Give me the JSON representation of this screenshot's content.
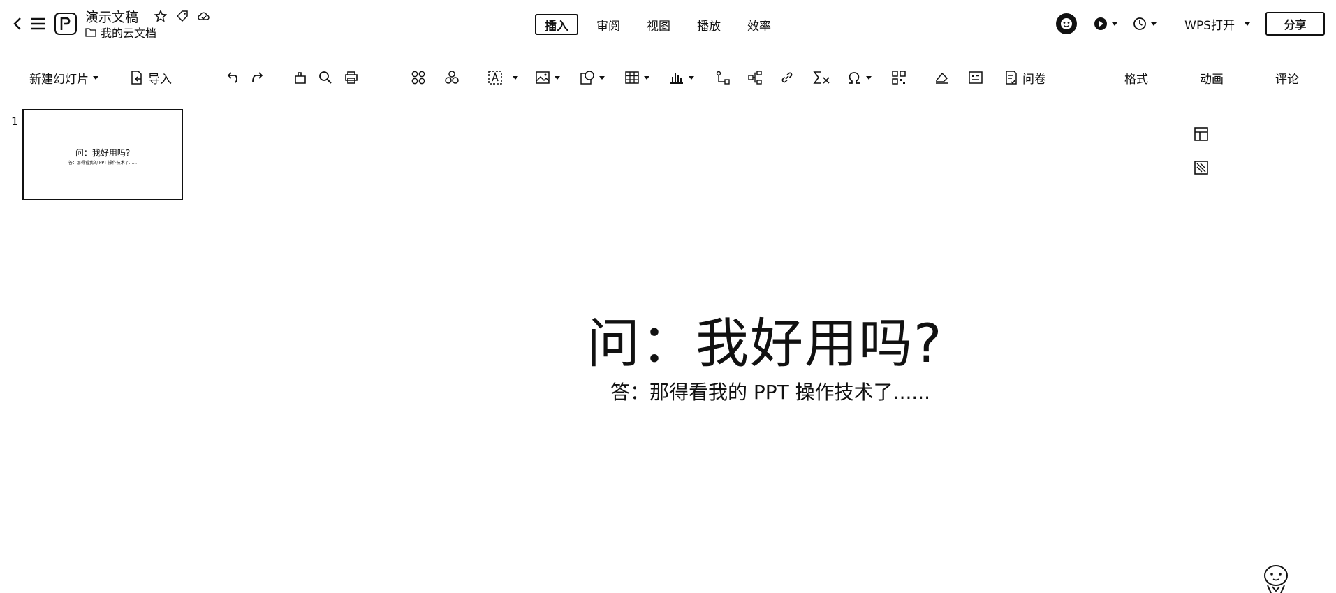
{
  "app": {
    "doc_title": "演示文稿",
    "location": "我的云文档"
  },
  "top_tabs": [
    {
      "label": "插入",
      "active": true
    },
    {
      "label": "审阅",
      "active": false
    },
    {
      "label": "视图",
      "active": false
    },
    {
      "label": "播放",
      "active": false
    },
    {
      "label": "效率",
      "active": false
    }
  ],
  "header_right": {
    "open_label": "WPS打开",
    "share_label": "分享"
  },
  "toolbar": {
    "new_slide": "新建幻灯片",
    "import": "导入",
    "questionnaire": "问卷",
    "format": "格式",
    "animation": "动画",
    "comment": "评论"
  },
  "slides": [
    {
      "number": "1",
      "title": "问：我好用吗?",
      "subtitle": "答：那得看我的 PPT 操作技术了......"
    }
  ],
  "canvas": {
    "title": "问：我好用吗?",
    "subtitle": "答：那得看我的 PPT 操作技术了......"
  }
}
